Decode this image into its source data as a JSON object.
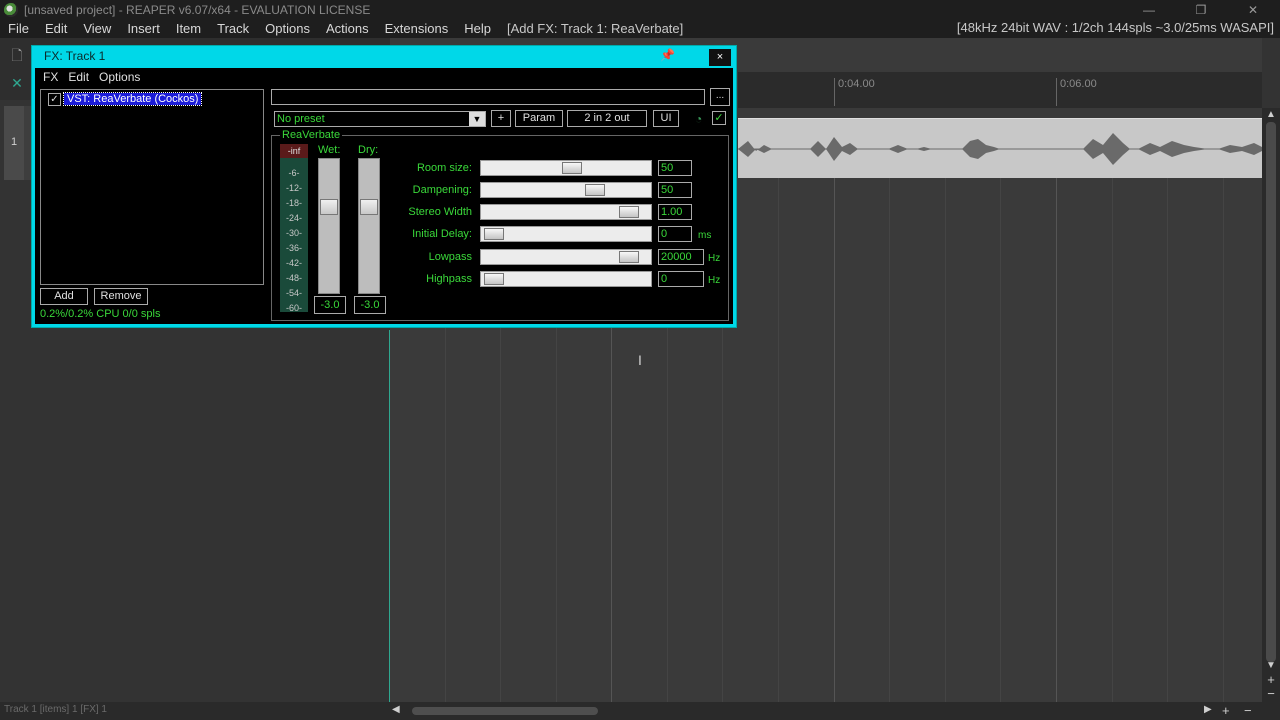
{
  "window": {
    "title": "[unsaved project] - REAPER v6.07/x64 - EVALUATION LICENSE",
    "minimize": "—",
    "restore": "❐",
    "close": "✕"
  },
  "menubar": {
    "items": [
      "File",
      "Edit",
      "View",
      "Insert",
      "Item",
      "Track",
      "Options",
      "Actions",
      "Extensions",
      "Help"
    ],
    "status": "[Add FX: Track 1: ReaVerbate]",
    "audio_info": "[48kHz 24bit WAV : 1/2ch 144spls ~3.0/25ms WASAPI]"
  },
  "track": {
    "number": "1"
  },
  "ruler": {
    "ticks": [
      "0:04.00",
      "0:06.00"
    ]
  },
  "fx_window": {
    "title": "FX: Track 1",
    "close_label": "×",
    "menu": [
      "FX",
      "Edit",
      "Options"
    ],
    "chain": [
      {
        "name": "VST: ReaVerbate (Cockos)",
        "enabled": true
      }
    ],
    "add_label": "Add",
    "remove_label": "Remove",
    "cpu": "0.2%/0.2% CPU 0/0 spls",
    "more_label": "...",
    "preset": "No preset",
    "plus_label": "+",
    "param_label": "Param",
    "io_label": "2 in 2 out",
    "ui_label": "UI",
    "plugin": {
      "name": "ReaVerbate",
      "meter_top": "-inf",
      "meter_ticks": [
        "-6-",
        "-12-",
        "-18-",
        "-24-",
        "-30-",
        "-36-",
        "-42-",
        "-48-",
        "-54-",
        "-60-"
      ],
      "wet_label": "Wet:",
      "dry_label": "Dry:",
      "wet_value": "-3.0",
      "dry_value": "-3.0",
      "params": [
        {
          "label": "Room size:",
          "value": "50",
          "unit": "",
          "position": 0.55
        },
        {
          "label": "Dampening:",
          "value": "50",
          "unit": "",
          "position": 0.7
        },
        {
          "label": "Stereo Width",
          "value": "1.00",
          "unit": "",
          "position": 0.93
        },
        {
          "label": "Initial Delay:",
          "value": "0",
          "unit": "ms",
          "position": 0.02
        },
        {
          "label": "Lowpass",
          "value": "20000",
          "unit": "Hz",
          "position": 0.93
        },
        {
          "label": "Highpass",
          "value": "0",
          "unit": "Hz",
          "position": 0.02
        }
      ]
    }
  },
  "statusbar": {
    "text": "Track 1 [items] 1 [FX] 1"
  },
  "colors": {
    "fx_border": "#00d8e8",
    "green_text": "#3ad83a",
    "selection": "#1c1cd8"
  }
}
